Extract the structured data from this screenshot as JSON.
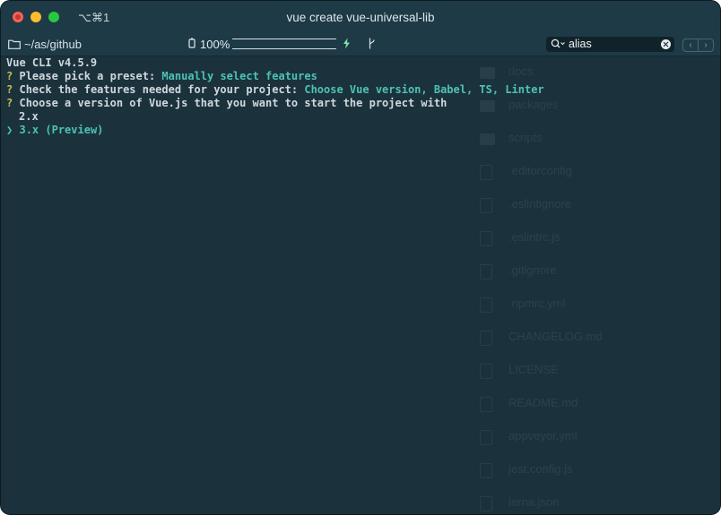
{
  "window": {
    "title": "vue create vue-universal-lib",
    "shortcut": "⌥⌘1"
  },
  "statusbar": {
    "path": "~/as/github",
    "battery": "100%",
    "battery_level": 1.0,
    "search_value": "alias",
    "prev_icon": "‹",
    "next_icon": "›"
  },
  "terminal": {
    "header": "Vue CLI v4.5.9",
    "prompts": [
      {
        "mark": "?",
        "question": "Please pick a preset: ",
        "answer": "Manually select features"
      },
      {
        "mark": "?",
        "question": "Check the features needed for your project: ",
        "answer": "Choose Vue version, Babel, TS, Linter"
      },
      {
        "mark": "?",
        "question": "Choose a version of Vue.js that you want to start the project with",
        "answer": ""
      }
    ],
    "options": [
      {
        "label": "2.x",
        "selected": false
      },
      {
        "pointer": "❯",
        "label": "3.x (Preview)",
        "selected": true
      }
    ]
  },
  "background_files": [
    {
      "name": "docs",
      "icon": "folder-icon"
    },
    {
      "name": "packages",
      "icon": "folder-icon"
    },
    {
      "name": "scripts",
      "icon": "folder-icon"
    },
    {
      "name": ".editorconfig",
      "icon": "file-icon"
    },
    {
      "name": ".eslintignore",
      "icon": "file-icon"
    },
    {
      "name": ".eslintrc.js",
      "icon": "file-icon"
    },
    {
      "name": ".gitignore",
      "icon": "file-icon"
    },
    {
      "name": ".npmrc.yml",
      "icon": "file-icon"
    },
    {
      "name": "CHANGELOG.md",
      "icon": "file-icon"
    },
    {
      "name": "LICENSE",
      "icon": "file-icon"
    },
    {
      "name": "README.md",
      "icon": "file-icon"
    },
    {
      "name": "appveyor.yml",
      "icon": "file-icon"
    },
    {
      "name": "jest.config.js",
      "icon": "file-icon"
    },
    {
      "name": "lerna.json",
      "icon": "file-icon"
    }
  ],
  "colors": {
    "terminal_bg": "#1b323d",
    "titlebar_bg": "#1e3a47",
    "prompt_mark": "#c6c24a",
    "answer": "#4ec2b3",
    "text": "#d0d8dc"
  }
}
